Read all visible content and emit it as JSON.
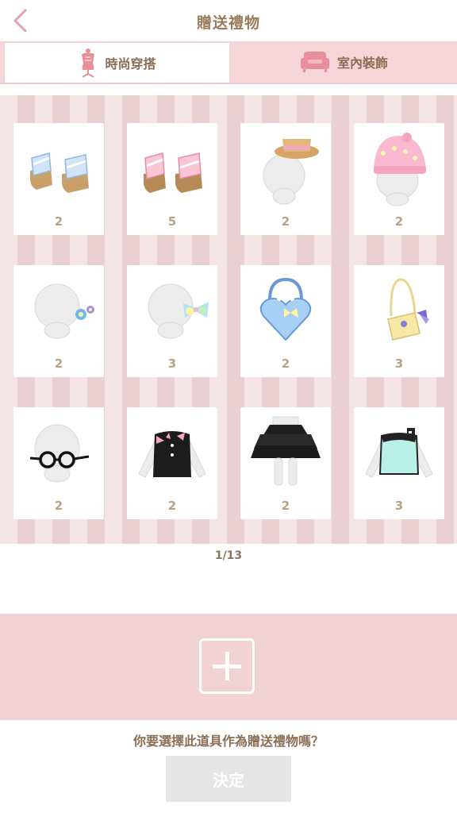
{
  "header": {
    "title": "贈送禮物"
  },
  "tabs": [
    {
      "label": "時尚穿搭",
      "icon": "mannequin-icon",
      "active": true
    },
    {
      "label": "室內裝飾",
      "icon": "sofa-icon",
      "active": false
    }
  ],
  "items": [
    {
      "name": "blue-sandals",
      "count": "2"
    },
    {
      "name": "pink-sandals",
      "count": "5"
    },
    {
      "name": "boater-hat",
      "count": "2"
    },
    {
      "name": "pink-flower-beanie",
      "count": "2"
    },
    {
      "name": "blue-flower-hairclip",
      "count": "2"
    },
    {
      "name": "pastel-ribbon-hairclip",
      "count": "3"
    },
    {
      "name": "blue-heart-handbag",
      "count": "2"
    },
    {
      "name": "yellow-shoulder-bag",
      "count": "3"
    },
    {
      "name": "round-glasses",
      "count": "2"
    },
    {
      "name": "black-ribbon-top",
      "count": "2"
    },
    {
      "name": "black-tiered-skirt",
      "count": "2"
    },
    {
      "name": "mint-top",
      "count": "3"
    }
  ],
  "pager": {
    "text": "1/13"
  },
  "gift_slot": {
    "icon": "plus-icon"
  },
  "question": "你要選擇此道具作為贈送禮物嗎？",
  "confirm_label": "決定",
  "colors": {
    "accent": "#e8a0a8",
    "text_brown": "#9a7b5c",
    "tab_bg": "#f4d6d9",
    "disabled": "#e5e5e5"
  }
}
